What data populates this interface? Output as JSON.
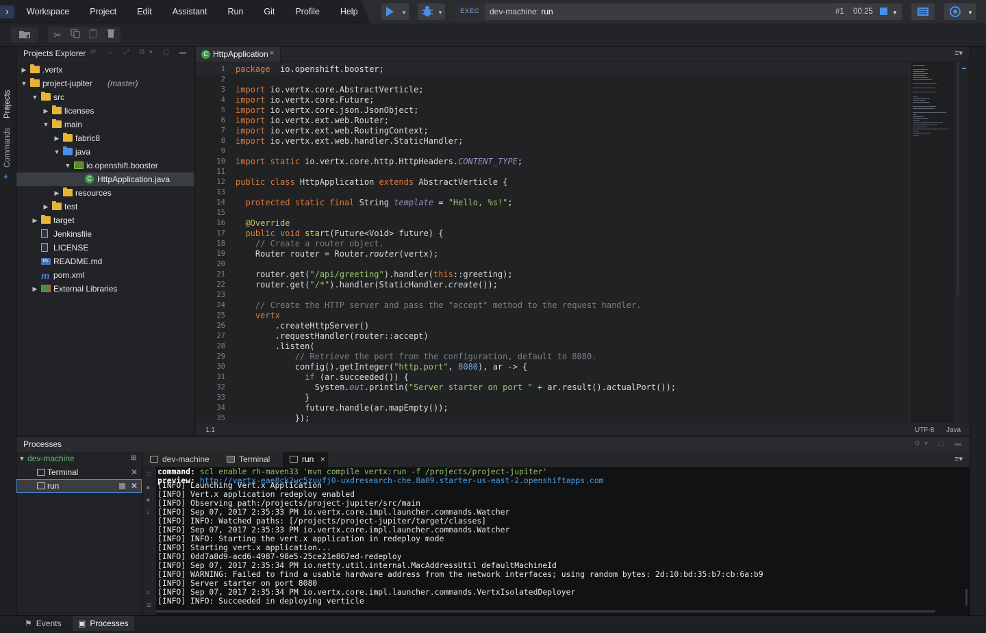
{
  "menu": {
    "items": [
      "Workspace",
      "Project",
      "Edit",
      "Assistant",
      "Run",
      "Git",
      "Profile",
      "Help"
    ]
  },
  "exec": {
    "label": "EXEC",
    "machine": "dev-machine:",
    "command": "run",
    "index": "#1",
    "time": "00:25"
  },
  "sidebar": {
    "tabs": [
      "Projects",
      "Commands"
    ]
  },
  "explorer": {
    "title": "Projects Explorer",
    "tree": [
      {
        "label": ".vertx",
        "depth": 0,
        "arrow": "right",
        "icon": "folder"
      },
      {
        "label": "project-jupiter",
        "branch": "(master)",
        "depth": 0,
        "arrow": "down",
        "icon": "folder"
      },
      {
        "label": "src",
        "depth": 1,
        "arrow": "down",
        "icon": "folder"
      },
      {
        "label": "licenses",
        "depth": 2,
        "arrow": "right",
        "icon": "folder"
      },
      {
        "label": "main",
        "depth": 2,
        "arrow": "down",
        "icon": "folder"
      },
      {
        "label": "fabric8",
        "depth": 3,
        "arrow": "right",
        "icon": "folder"
      },
      {
        "label": "java",
        "depth": 3,
        "arrow": "down",
        "icon": "folder-blue"
      },
      {
        "label": "io.openshift.booster",
        "depth": 4,
        "arrow": "down",
        "icon": "package"
      },
      {
        "label": "HttpApplication.java",
        "depth": 5,
        "arrow": "",
        "icon": "class",
        "selected": true
      },
      {
        "label": "resources",
        "depth": 3,
        "arrow": "right",
        "icon": "folder"
      },
      {
        "label": "test",
        "depth": 2,
        "arrow": "right",
        "icon": "folder"
      },
      {
        "label": "target",
        "depth": 1,
        "arrow": "right",
        "icon": "folder"
      },
      {
        "label": "Jenkinsfile",
        "depth": 1,
        "arrow": "",
        "icon": "file"
      },
      {
        "label": "LICENSE",
        "depth": 1,
        "arrow": "",
        "icon": "file"
      },
      {
        "label": "README.md",
        "depth": 1,
        "arrow": "",
        "icon": "markdown"
      },
      {
        "label": "pom.xml",
        "depth": 1,
        "arrow": "",
        "icon": "maven"
      },
      {
        "label": "External Libraries",
        "depth": 1,
        "arrow": "right",
        "icon": "library"
      }
    ]
  },
  "editor": {
    "tab_label": "HttpApplication",
    "tab_close": "×",
    "class_icon_letter": "C",
    "status_position": "1:1",
    "status_encoding": "UTF-8",
    "status_language": "Java",
    "lines": [
      [
        [
          "kw",
          "package"
        ],
        [
          "",
          "  io.openshift.booster;"
        ]
      ],
      [],
      [
        [
          "kw",
          "import"
        ],
        [
          "",
          " io.vertx.core.AbstractVerticle;"
        ]
      ],
      [
        [
          "kw",
          "import"
        ],
        [
          "",
          " io.vertx.core.Future;"
        ]
      ],
      [
        [
          "kw",
          "import"
        ],
        [
          "",
          " io.vertx.core.json.JsonObject;"
        ]
      ],
      [
        [
          "kw",
          "import"
        ],
        [
          "",
          " io.vertx.ext.web.Router;"
        ]
      ],
      [
        [
          "kw",
          "import"
        ],
        [
          "",
          " io.vertx.ext.web.RoutingContext;"
        ]
      ],
      [
        [
          "kw",
          "import"
        ],
        [
          "",
          " io.vertx.ext.web.handler.StaticHandler;"
        ]
      ],
      [],
      [
        [
          "kw",
          "import static"
        ],
        [
          "",
          " io.vertx.core.http.HttpHeaders."
        ],
        [
          "it",
          "CONTENT_TYPE"
        ],
        [
          "",
          ";"
        ]
      ],
      [],
      [
        [
          "kw",
          "public class"
        ],
        [
          "",
          " HttpApplication "
        ],
        [
          "kw",
          "extends"
        ],
        [
          "",
          " AbstractVerticle {"
        ]
      ],
      [],
      [
        [
          "",
          "  "
        ],
        [
          "kw",
          "protected static final"
        ],
        [
          "",
          " String "
        ],
        [
          "it",
          "template"
        ],
        [
          "",
          " = "
        ],
        [
          "str",
          "\"Hello, %s!\""
        ],
        [
          "",
          ";"
        ]
      ],
      [],
      [
        [
          "",
          "  "
        ],
        [
          "ann",
          "@Override"
        ]
      ],
      [
        [
          "",
          "  "
        ],
        [
          "kw",
          "public void"
        ],
        [
          "",
          " "
        ],
        [
          "fn",
          "start"
        ],
        [
          "",
          "(Future<Void> future) {"
        ]
      ],
      [
        [
          "cmt",
          "    // Create a router object."
        ]
      ],
      [
        [
          "",
          "    Router router = Router."
        ],
        [
          "ital",
          "router"
        ],
        [
          "",
          "(vertx);"
        ]
      ],
      [],
      [
        [
          "",
          "    router.get("
        ],
        [
          "str",
          "\"/api/greeting\""
        ],
        [
          "",
          ").handler("
        ],
        [
          "kw",
          "this"
        ],
        [
          "",
          "::greeting);"
        ]
      ],
      [
        [
          "",
          "    router.get("
        ],
        [
          "str",
          "\"/*\""
        ],
        [
          "",
          ").handler(StaticHandler."
        ],
        [
          "ital",
          "create"
        ],
        [
          "",
          "());"
        ]
      ],
      [],
      [
        [
          "cmt",
          "    // Create the HTTP server and pass the \"accept\" method to the request handler."
        ]
      ],
      [
        [
          "kw",
          "    vertx"
        ]
      ],
      [
        [
          "",
          "        .createHttpServer()"
        ]
      ],
      [
        [
          "",
          "        .requestHandler(router::accept)"
        ]
      ],
      [
        [
          "",
          "        .listen("
        ]
      ],
      [
        [
          "cmt",
          "            // Retrieve the port from the configuration, default to 8080."
        ]
      ],
      [
        [
          "",
          "            config().getInteger("
        ],
        [
          "str",
          "\"http.port\""
        ],
        [
          "",
          ", "
        ],
        [
          "num",
          "8080"
        ],
        [
          "",
          "), ar -> {"
        ]
      ],
      [
        [
          "kw",
          "              if"
        ],
        [
          "",
          " (ar.succeeded()) {"
        ]
      ],
      [
        [
          "",
          "                System."
        ],
        [
          "it",
          "out"
        ],
        [
          "",
          ".println("
        ],
        [
          "str",
          "\"Server starter on port \""
        ],
        [
          "",
          " + ar.result().actualPort());"
        ]
      ],
      [
        [
          "",
          "              }"
        ]
      ],
      [
        [
          "",
          "              future.handle(ar.mapEmpty());"
        ]
      ],
      [
        [
          "",
          "            });"
        ]
      ]
    ]
  },
  "processes": {
    "title": "Processes",
    "machine": "dev-machine",
    "items": [
      "Terminal",
      "run"
    ],
    "tabs": [
      "dev-machine",
      "Terminal",
      "run"
    ],
    "tab_close": "×"
  },
  "console": {
    "command_key": "command:",
    "command_value": "scl enable rh-maven33 'mvn compile vertx:run -f /projects/project-jupiter'",
    "preview_key": "preview:",
    "preview_value": "http://vertx-eae8ck2wc5zuvfj0-uxdresearch-che.8a09.starter-us-east-2.openshiftapps.com",
    "lines": [
      "[INFO] Launching Vert.x Application",
      "[INFO] Vert.x application redeploy enabled",
      "[INFO] Observing path:/projects/project-jupiter/src/main",
      "[INFO] Sep 07, 2017 2:35:33 PM io.vertx.core.impl.launcher.commands.Watcher",
      "[INFO] INFO: Watched paths: [/projects/project-jupiter/target/classes]",
      "[INFO] Sep 07, 2017 2:35:33 PM io.vertx.core.impl.launcher.commands.Watcher",
      "[INFO] INFO: Starting the vert.x application in redeploy mode",
      "[INFO] Starting vert.x application...",
      "[INFO] 0dd7a8d9-acd6-4987-98e5-25ce21e867ed-redeploy",
      "[INFO] Sep 07, 2017 2:35:34 PM io.netty.util.internal.MacAddressUtil defaultMachineId",
      "[INFO] WARNING: Failed to find a usable hardware address from the network interfaces; using random bytes: 2d:10:bd:35:b7:cb:6a:b9",
      "[INFO] Server starter on port 8080",
      "[INFO] Sep 07, 2017 2:35:34 PM io.vertx.core.impl.launcher.commands.VertxIsolatedDeployer",
      "[INFO] INFO: Succeeded in deploying verticle"
    ]
  },
  "bottombar": {
    "tabs": [
      "Events",
      "Processes"
    ]
  }
}
